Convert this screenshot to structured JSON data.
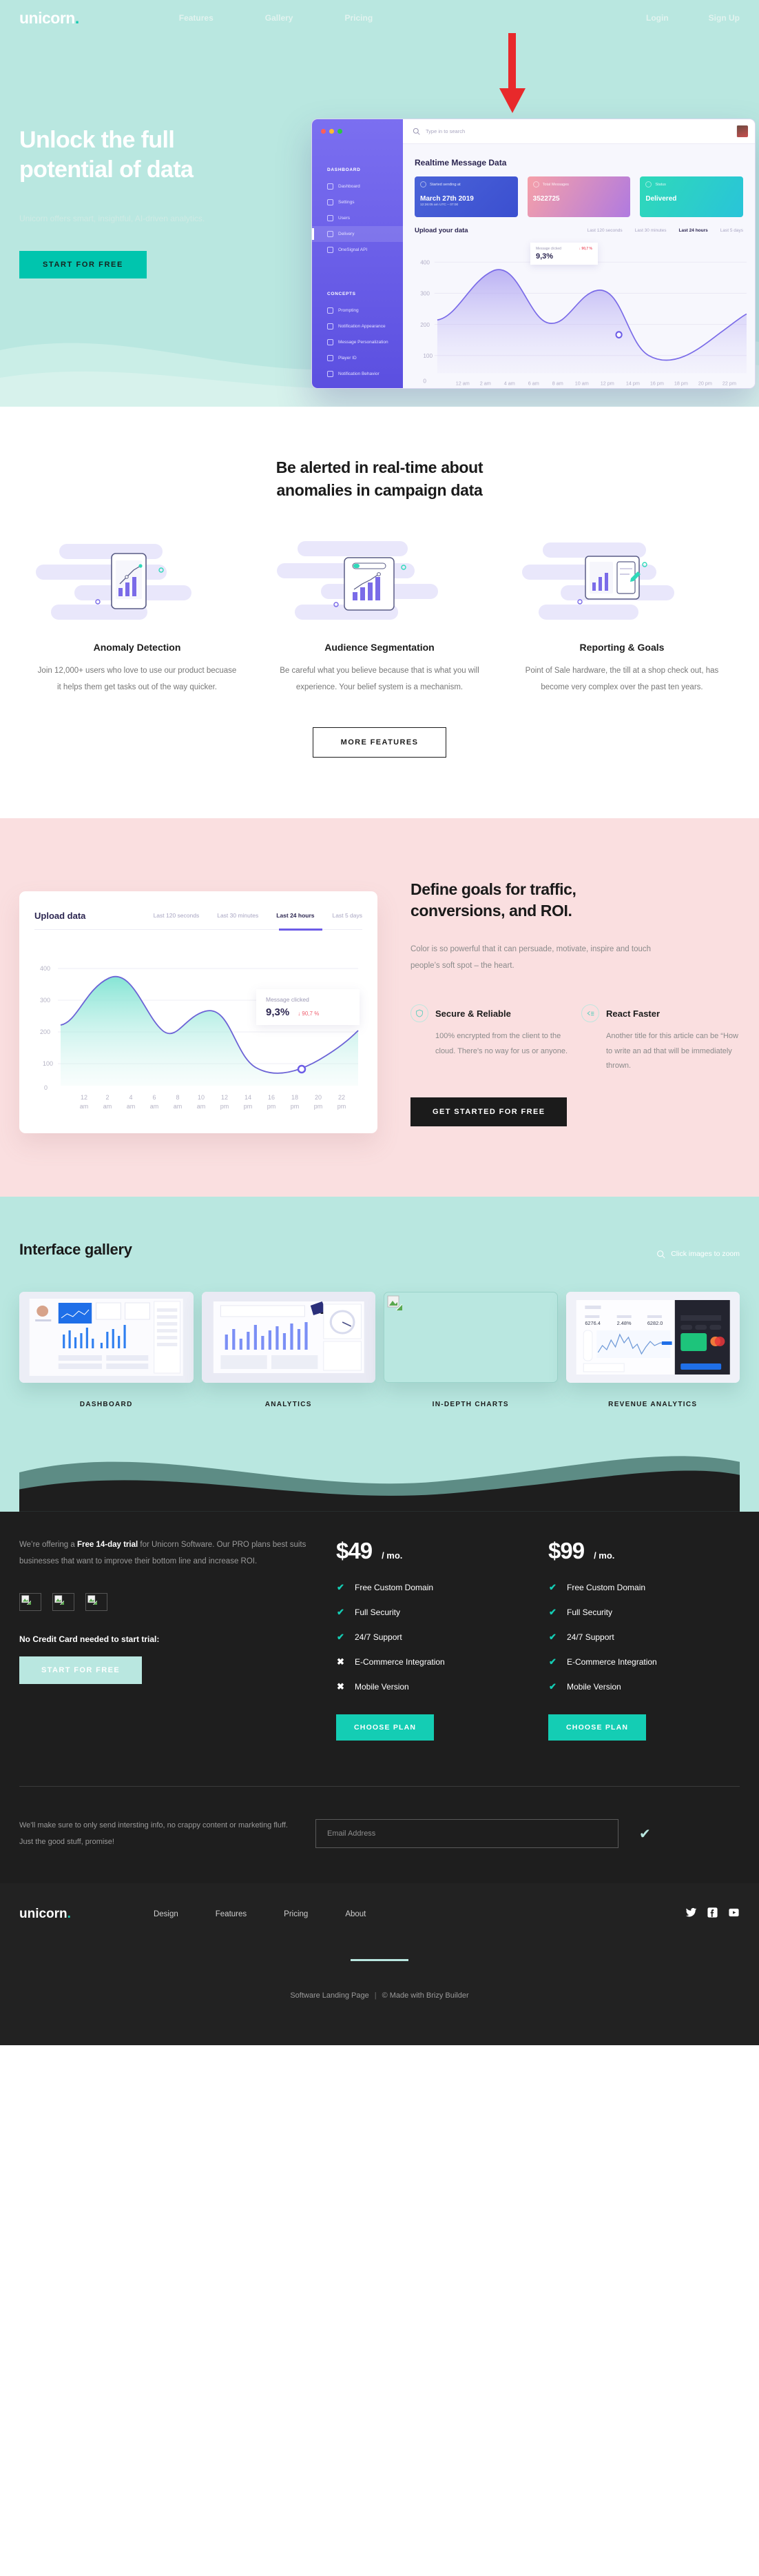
{
  "brand": {
    "name": "unicorn",
    "dot": "."
  },
  "nav": {
    "links": [
      {
        "label": "Features"
      },
      {
        "label": "Gallery"
      },
      {
        "label": "Pricing"
      }
    ],
    "right": [
      {
        "label": "Login"
      },
      {
        "label": "Sign Up"
      }
    ]
  },
  "hero": {
    "title_line1": "Unlock the full",
    "title_line2": "potential of data",
    "subtitle": "Unicorn offers smart, insightful, AI-driven analytics.",
    "cta": "START FOR FREE",
    "annotation": "red-down-arrow"
  },
  "dashboard_mock": {
    "search_placeholder": "Type in to search",
    "title": "Realtime Message Data",
    "sidebar": {
      "section_1": "DASHBOARD",
      "items_1": [
        "Dashboard",
        "Settings",
        "Users",
        "Delivery",
        "OneSignal API"
      ],
      "active": "Delivery",
      "section_2": "CONCEPTS",
      "items_2": [
        "Prompting",
        "Notification Appearance",
        "Message Personalization",
        "Player ID",
        "Notification Behavior"
      ]
    },
    "kpis": [
      {
        "label": "Started sending at",
        "value": "March 27th 2019",
        "sub": "12:26:05 am UTC – 07:00"
      },
      {
        "label": "Total Messages",
        "value": "3522725",
        "sub": ""
      },
      {
        "label": "Status",
        "value": "Delivered",
        "sub": ""
      }
    ],
    "upload_label": "Upload your data",
    "ranges": [
      "Last 120 seconds",
      "Last 30 minutes",
      "Last 24 hours",
      "Last 5 days"
    ],
    "range_active": "Last 24 hours",
    "tooltip": {
      "label": "Message clicked",
      "delta": "↓ 90,7 %",
      "value": "9,3%"
    }
  },
  "features": {
    "heading_line1": "Be alerted in real-time about",
    "heading_line2": "anomalies in campaign data",
    "cards": [
      {
        "illustration": "mobile-chart-illustration",
        "title": "Anomaly Detection",
        "text": "Join 12,000+ users who love to use our product becuase it helps them get tasks out of the way quicker."
      },
      {
        "illustration": "scroll-report-illustration",
        "title": "Audience Segmentation",
        "text": "Be careful what you believe because that is what you will experience. Your belief system is a mechanism."
      },
      {
        "illustration": "tablet-edit-illustration",
        "title": "Reporting & Goals",
        "text": "Point of Sale hardware, the till at a shop check out, has become very complex over the past ten years."
      }
    ],
    "more_button": "MORE FEATURES"
  },
  "goals": {
    "heading_line1": "Define goals for traffic,",
    "heading_line2": "conversions, and ROI.",
    "paragraph": "Color is so powerful that it can persuade, motivate, inspire and touch people’s soft spot – the heart.",
    "items": [
      {
        "icon": "shield-icon",
        "title": "Secure & Reliable",
        "text": "100% encrypted from the client to the cloud. There's no way for us or anyone."
      },
      {
        "icon": "reply-list-icon",
        "title": "React Faster",
        "text": "Another title for this article can be “How to write an ad that will be immediately thrown."
      }
    ],
    "cta": "GET STARTED FOR FREE",
    "card": {
      "label": "Upload data",
      "ranges": [
        "Last 120 seconds",
        "Last 30 minutes",
        "Last 24 hours",
        "Last 5 days"
      ],
      "range_active": "Last 24 hours",
      "tooltip": {
        "label": "Message clicked",
        "value": "9,3%",
        "delta": "↓ 90,7 %"
      }
    }
  },
  "chart_data": {
    "type": "area",
    "title": "Upload data",
    "xlabel": "",
    "ylabel": "",
    "ylim": [
      0,
      450
    ],
    "yticks": [
      100,
      200,
      300,
      400
    ],
    "grid": true,
    "legend": "none",
    "x": [
      "0",
      "12 am",
      "2 am",
      "4 am",
      "6 am",
      "8 am",
      "10 am",
      "12 pm",
      "14 pm",
      "16 pm",
      "18 pm",
      "20 pm",
      "22 pm"
    ],
    "series": [
      {
        "name": "Messages",
        "values": [
          null,
          225,
          300,
          368,
          300,
          212,
          240,
          275,
          225,
          160,
          120,
          135,
          180
        ]
      }
    ],
    "annotation": {
      "label": "Message clicked",
      "value": "9,3%",
      "delta": "↓ 90,7 %",
      "at_x": "20 pm"
    }
  },
  "gallery": {
    "heading": "Interface gallery",
    "zoom_hint": "Click images to zoom",
    "items": [
      {
        "caption": "DASHBOARD",
        "thumb": "dashboard-screenshot",
        "broken": false
      },
      {
        "caption": "ANALYTICS",
        "thumb": "analytics-screenshot",
        "broken": false
      },
      {
        "caption": "IN-DEPTH CHARTS",
        "thumb": "broken-image-placeholder",
        "broken": true
      },
      {
        "caption": "REVENUE ANALYTICS",
        "thumb": "revenue-analytics-screenshot",
        "broken": false
      }
    ]
  },
  "pricing": {
    "lead_pre": "We’re offering a ",
    "lead_bold": "Free 14-day trial",
    "lead_post": " for Unicorn Software. Our PRO plans best suits businesses that want to improve their bottom line and increase ROI.",
    "logos": [
      "broken-image-placeholder",
      "broken-image-placeholder",
      "broken-image-placeholder"
    ],
    "no_card_label": "No Credit Card needed to start trial:",
    "start_button": "START FOR FREE",
    "plans": [
      {
        "amount": "$49",
        "period": "/ mo.",
        "features": [
          {
            "label": "Free Custom Domain",
            "included": true
          },
          {
            "label": "Full Security",
            "included": true
          },
          {
            "label": "24/7 Support",
            "included": true
          },
          {
            "label": "E-Commerce Integration",
            "included": false
          },
          {
            "label": "Mobile Version",
            "included": false
          }
        ],
        "cta": "CHOOSE PLAN"
      },
      {
        "amount": "$99",
        "period": "/ mo.",
        "features": [
          {
            "label": "Free Custom Domain",
            "included": true
          },
          {
            "label": "Full Security",
            "included": true
          },
          {
            "label": "24/7 Support",
            "included": true
          },
          {
            "label": "E-Commerce Integration",
            "included": true
          },
          {
            "label": "Mobile Version",
            "included": true
          }
        ],
        "cta": "CHOOSE PLAN"
      }
    ]
  },
  "newsletter": {
    "text": "We'll make sure to only send intersting info, no crappy content or marketing fluff. Just the good stuff, promise!",
    "placeholder": "Email Address",
    "value": "",
    "submit_icon": "check-icon"
  },
  "footer": {
    "links": [
      {
        "label": "Design"
      },
      {
        "label": "Features"
      },
      {
        "label": "Pricing"
      },
      {
        "label": "About"
      }
    ],
    "social": [
      "twitter-icon",
      "facebook-icon",
      "youtube-icon"
    ],
    "copy_left": "Software Landing Page",
    "copy_right": "© Made with Brizy Builder"
  },
  "colors": {
    "mint": "#b9e7e0",
    "teal": "#14cdb4",
    "pink": "#fadfe0",
    "dark": "#1e1e1e",
    "purple": "#6c5ce7",
    "arrow_red": "#e8292b"
  }
}
